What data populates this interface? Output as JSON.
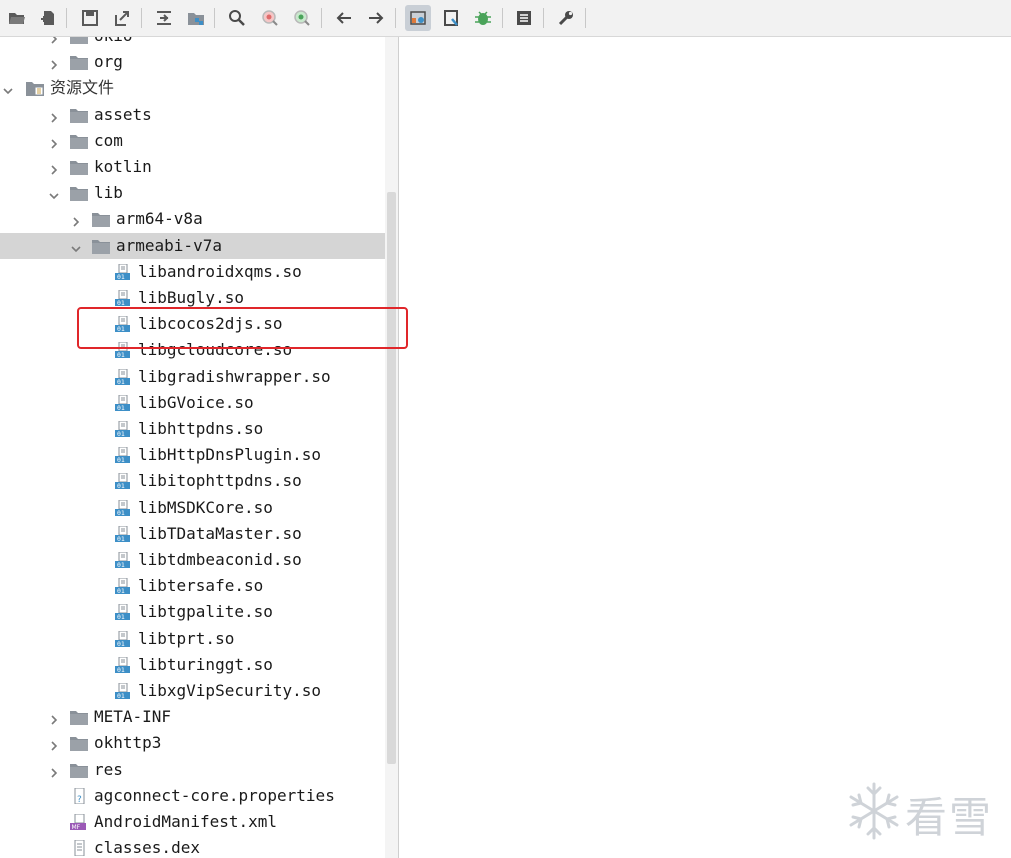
{
  "toolbar": {
    "buttons": [
      {
        "name": "open-file",
        "icon": "folder-open-icon"
      },
      {
        "name": "add-files",
        "icon": "add-file-icon"
      },
      {
        "name": "save-all",
        "icon": "save-icon"
      },
      {
        "name": "export",
        "icon": "export-icon"
      },
      {
        "name": "sync-tree",
        "icon": "sync-icon"
      },
      {
        "name": "flatten-packages",
        "icon": "package-icon"
      },
      {
        "name": "search",
        "icon": "search-icon"
      },
      {
        "name": "find-class",
        "icon": "find-class-icon"
      },
      {
        "name": "find-usage",
        "icon": "find-usage-icon"
      },
      {
        "name": "back",
        "icon": "arrow-left-icon"
      },
      {
        "name": "forward",
        "icon": "arrow-right-icon"
      },
      {
        "name": "deobfuscation",
        "icon": "deobf-icon",
        "active": true
      },
      {
        "name": "quick-view",
        "icon": "bookmark-icon"
      },
      {
        "name": "debug",
        "icon": "bug-icon"
      },
      {
        "name": "log",
        "icon": "log-icon"
      },
      {
        "name": "preferences",
        "icon": "wrench-icon"
      }
    ]
  },
  "tree": {
    "rows": [
      {
        "label": "okio",
        "depth": 1,
        "arrow": "collapsed",
        "icon": "folder"
      },
      {
        "label": "org",
        "depth": 1,
        "arrow": "collapsed",
        "icon": "folder"
      },
      {
        "label": "资源文件",
        "depth": 0,
        "arrow": "expanded",
        "icon": "resources-folder",
        "cjk": true
      },
      {
        "label": "assets",
        "depth": 1,
        "arrow": "collapsed",
        "icon": "folder"
      },
      {
        "label": "com",
        "depth": 1,
        "arrow": "collapsed",
        "icon": "folder"
      },
      {
        "label": "kotlin",
        "depth": 1,
        "arrow": "collapsed",
        "icon": "folder"
      },
      {
        "label": "lib",
        "depth": 1,
        "arrow": "expanded",
        "icon": "folder"
      },
      {
        "label": "arm64-v8a",
        "depth": 2,
        "arrow": "collapsed",
        "icon": "folder"
      },
      {
        "label": "armeabi-v7a",
        "depth": 2,
        "arrow": "expanded",
        "icon": "folder",
        "selected": true
      },
      {
        "label": "libandroidxqms.so",
        "depth": 3,
        "icon": "binary-file"
      },
      {
        "label": "libBugly.so",
        "depth": 3,
        "icon": "binary-file"
      },
      {
        "label": "libcocos2djs.so",
        "depth": 3,
        "icon": "binary-file"
      },
      {
        "label": "libgcloudcore.so",
        "depth": 3,
        "icon": "binary-file"
      },
      {
        "label": "libgradishwrapper.so",
        "depth": 3,
        "icon": "binary-file"
      },
      {
        "label": "libGVoice.so",
        "depth": 3,
        "icon": "binary-file"
      },
      {
        "label": "libhttpdns.so",
        "depth": 3,
        "icon": "binary-file"
      },
      {
        "label": "libHttpDnsPlugin.so",
        "depth": 3,
        "icon": "binary-file"
      },
      {
        "label": "libitophttpdns.so",
        "depth": 3,
        "icon": "binary-file"
      },
      {
        "label": "libMSDKCore.so",
        "depth": 3,
        "icon": "binary-file"
      },
      {
        "label": "libTDataMaster.so",
        "depth": 3,
        "icon": "binary-file"
      },
      {
        "label": "libtdmbeaconid.so",
        "depth": 3,
        "icon": "binary-file"
      },
      {
        "label": "libtersafe.so",
        "depth": 3,
        "icon": "binary-file"
      },
      {
        "label": "libtgpalite.so",
        "depth": 3,
        "icon": "binary-file"
      },
      {
        "label": "libtprt.so",
        "depth": 3,
        "icon": "binary-file"
      },
      {
        "label": "libturinggt.so",
        "depth": 3,
        "icon": "binary-file"
      },
      {
        "label": "libxgVipSecurity.so",
        "depth": 3,
        "icon": "binary-file"
      },
      {
        "label": "META-INF",
        "depth": 1,
        "arrow": "collapsed",
        "icon": "folder"
      },
      {
        "label": "okhttp3",
        "depth": 1,
        "arrow": "collapsed",
        "icon": "folder"
      },
      {
        "label": "res",
        "depth": 1,
        "arrow": "collapsed",
        "icon": "folder"
      },
      {
        "label": "agconnect-core.properties",
        "depth": 1,
        "icon": "properties-file"
      },
      {
        "label": "AndroidManifest.xml",
        "depth": 1,
        "icon": "manifest-file"
      },
      {
        "label": "classes.dex",
        "depth": 1,
        "icon": "dex-file"
      }
    ]
  },
  "highlighted_item": "libcocos2djs.so",
  "watermark": {
    "text": "看雪"
  },
  "colors": {
    "selection": "#d5d5d5",
    "highlight_border": "#e0262a",
    "folder": "#8a9199",
    "binary_badge": "#3d8fc7"
  }
}
